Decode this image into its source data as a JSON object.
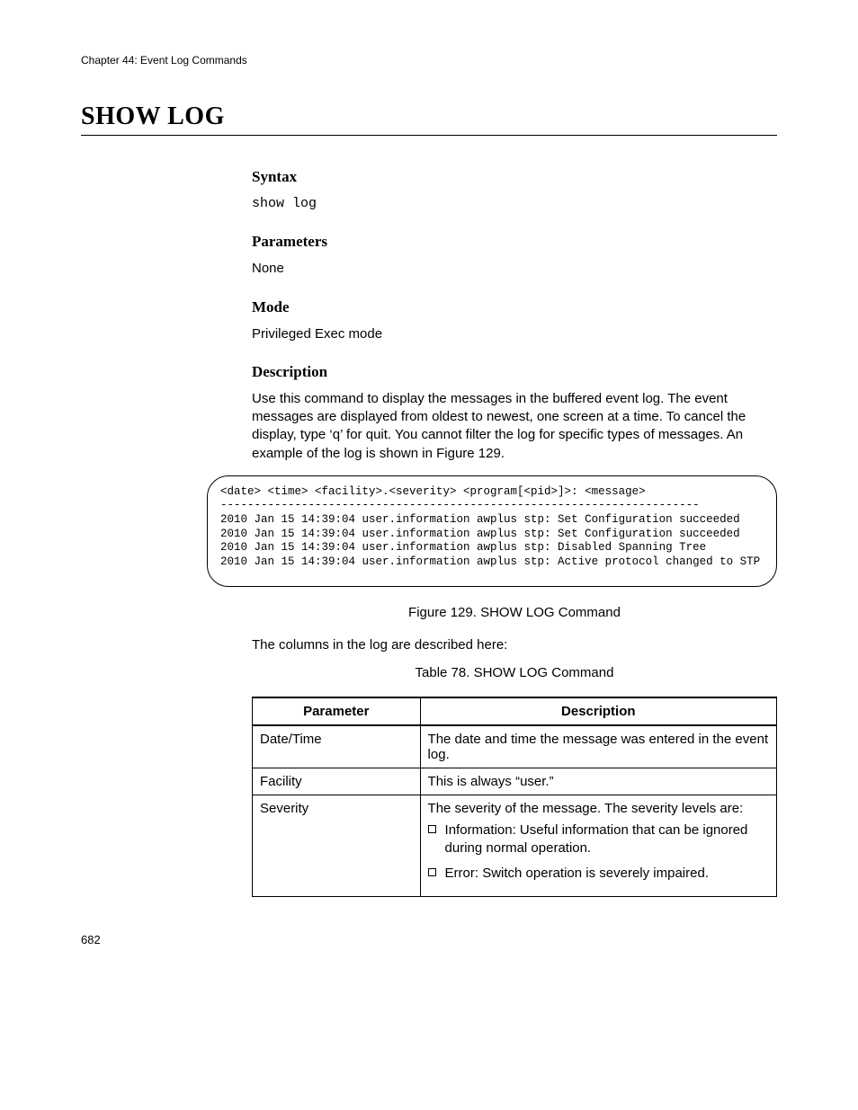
{
  "header": {
    "chapter": "Chapter 44: Event Log Commands"
  },
  "title": "SHOW LOG",
  "sections": {
    "syntax": {
      "heading": "Syntax",
      "code": "show log"
    },
    "parameters": {
      "heading": "Parameters",
      "text": "None"
    },
    "mode": {
      "heading": "Mode",
      "text": "Privileged Exec mode"
    },
    "description": {
      "heading": "Description",
      "text": "Use this command to display the messages in the buffered event log. The event messages are displayed from oldest to newest, one screen at a time. To cancel the display, type ‘q’ for quit. You cannot filter the log for specific types of messages. An example of the log is shown in Figure 129."
    }
  },
  "code_example": "<date> <time> <facility>.<severity> <program[<pid>]>: <message>\n-----------------------------------------------------------------------\n2010 Jan 15 14:39:04 user.information awplus stp: Set Configuration succeeded\n2010 Jan 15 14:39:04 user.information awplus stp: Set Configuration succeeded\n2010 Jan 15 14:39:04 user.information awplus stp: Disabled Spanning Tree\n2010 Jan 15 14:39:04 user.information awplus stp: Active protocol changed to STP",
  "figure_caption": "Figure 129. SHOW LOG Command",
  "columns_intro": "The columns in the log are described here:",
  "table_caption": "Table 78. SHOW LOG Command",
  "table": {
    "headers": {
      "param": "Parameter",
      "desc": "Description"
    },
    "rows": [
      {
        "param": "Date/Time",
        "desc": "The date and time the message was entered in the event log."
      },
      {
        "param": "Facility",
        "desc": "This is always “user.”"
      },
      {
        "param": "Severity",
        "desc": "The severity of the message. The severity levels are:",
        "items": [
          "Information: Useful information that can be ignored during normal operation.",
          "Error: Switch operation is severely impaired."
        ]
      }
    ]
  },
  "page_number": "682"
}
